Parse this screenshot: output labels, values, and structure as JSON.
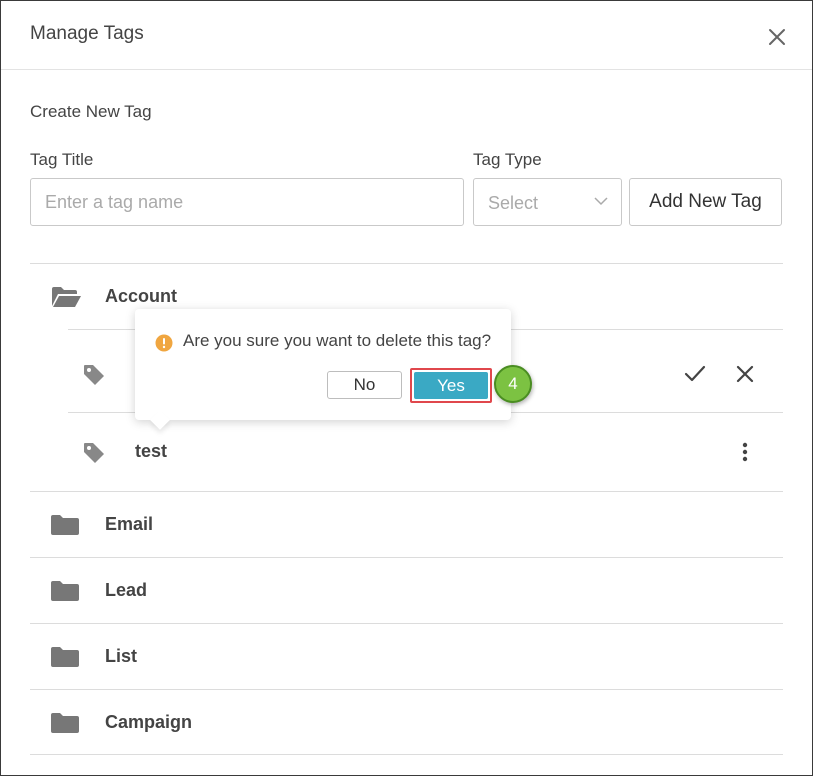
{
  "header": {
    "title": "Manage Tags"
  },
  "create": {
    "section_title": "Create New Tag",
    "tag_title_label": "Tag Title",
    "tag_title_placeholder": "Enter a tag name",
    "tag_type_label": "Tag Type",
    "tag_type_value": "Select",
    "add_button": "Add New Tag"
  },
  "categories": [
    {
      "label": "Account"
    },
    {
      "label": "Email"
    },
    {
      "label": "Lead"
    },
    {
      "label": "List"
    },
    {
      "label": "Campaign"
    }
  ],
  "account_tags": [
    {
      "label": ""
    },
    {
      "label": "test"
    }
  ],
  "popover": {
    "message": "Are you sure you want to delete this tag?",
    "no_label": "No",
    "yes_label": "Yes"
  },
  "step_badge": "4",
  "icons": {
    "close": "close-icon",
    "folder_open": "folder-open-icon",
    "folder": "folder-icon",
    "tag": "tag-icon",
    "check": "check-icon",
    "cancel": "close-icon",
    "more": "more-vertical-icon",
    "warning": "warning-icon",
    "chevron": "chevron-down-icon"
  },
  "colors": {
    "yes_button": "#3aa9c4",
    "highlight": "#e0474c",
    "badge": "#7cc242",
    "warning": "#f0a640",
    "icon_gray": "#777777"
  }
}
